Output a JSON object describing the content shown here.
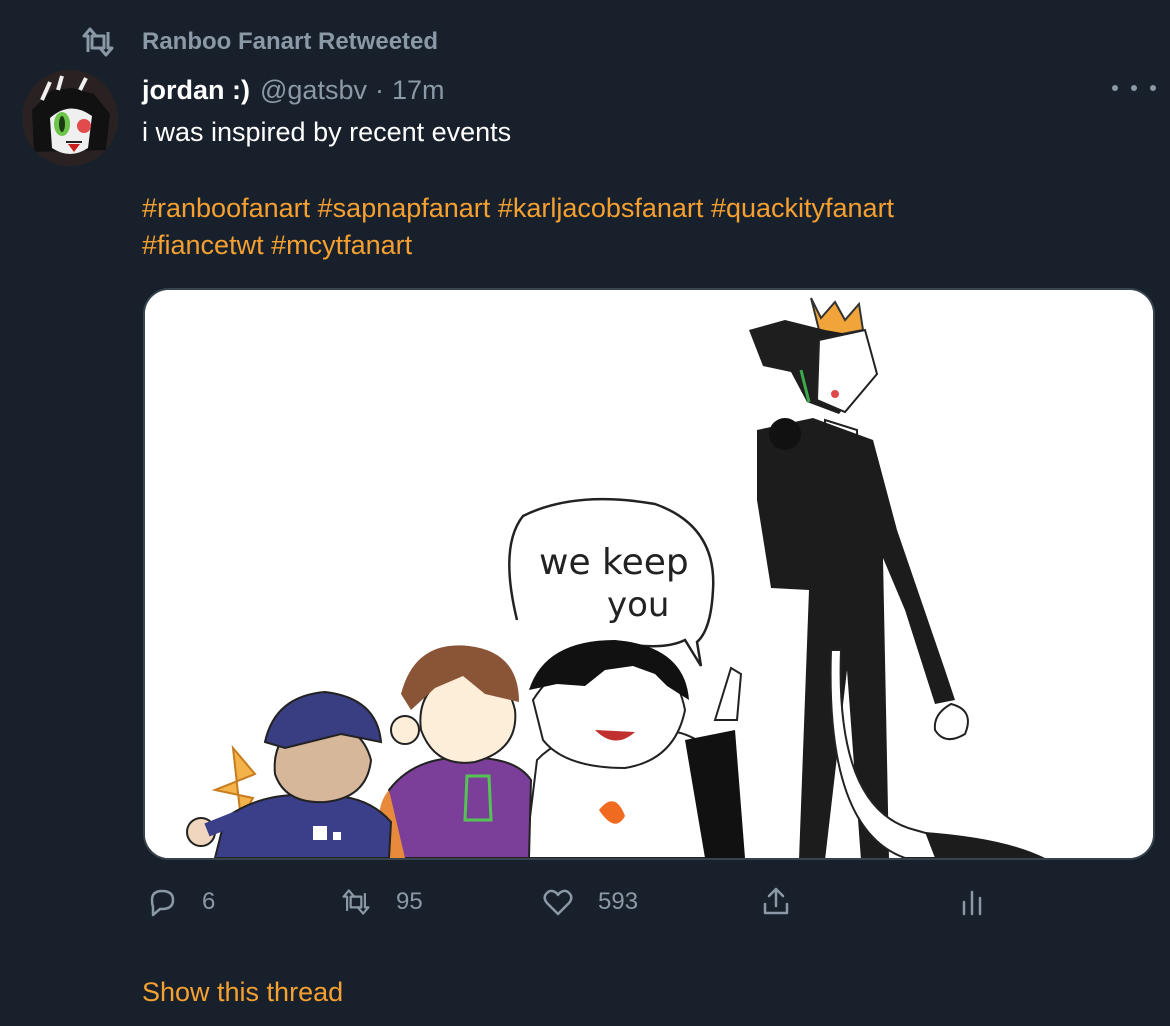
{
  "retweet_context": {
    "label": "Ranboo Fanart Retweeted",
    "icon": "retweet-icon"
  },
  "tweet": {
    "author_name": "jordan :)",
    "handle": "@gatsbv",
    "separator": "·",
    "timestamp": "17m",
    "text": "i was inspired by recent events",
    "hashtags": [
      "#ranboofanart",
      "#sapnapfanart",
      "#karljacobsfanart",
      "#quackityfanart",
      "#fiancetwt",
      "#mcytfanart"
    ],
    "speech_bubble_text": [
      "we keep",
      "you"
    ]
  },
  "actions": {
    "reply": {
      "icon": "reply-icon",
      "count": "6"
    },
    "retweet": {
      "icon": "retweet-icon",
      "count": "95"
    },
    "like": {
      "icon": "heart-icon",
      "count": "593"
    },
    "share": {
      "icon": "share-icon"
    },
    "analytics": {
      "icon": "analytics-icon"
    }
  },
  "show_thread_label": "Show this thread",
  "colors": {
    "background": "#17202b",
    "accent": "#f5a030",
    "text_primary": "#ffffff",
    "text_secondary": "#8b98a5",
    "border": "#38444d"
  }
}
